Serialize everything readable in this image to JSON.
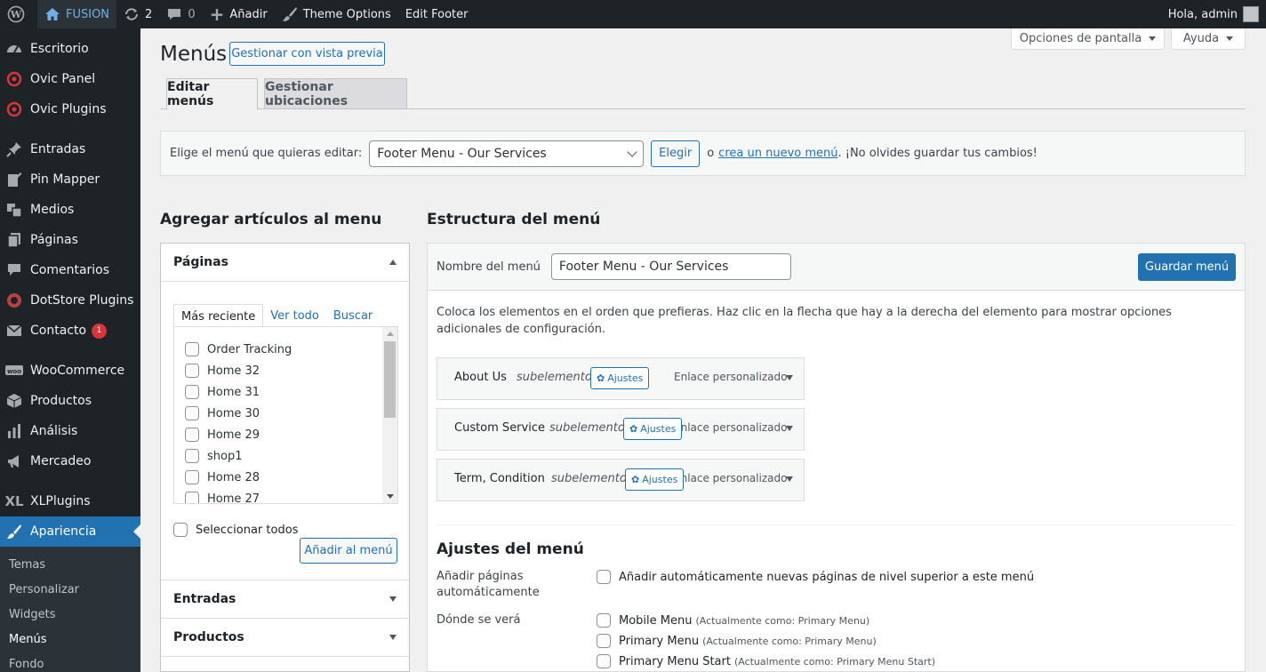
{
  "adminbar": {
    "site_name": "FUSION",
    "updates_count": "2",
    "comments_count": "0",
    "add_new": "Añadir",
    "theme_options": "Theme Options",
    "edit_footer": "Edit Footer",
    "greeting": "Hola, admin"
  },
  "sidebar": {
    "items": [
      {
        "label": "Escritorio",
        "icon": "dashboard-icon"
      },
      {
        "label": "Ovic Panel",
        "icon": "target-icon"
      },
      {
        "label": "Ovic Plugins",
        "icon": "target-icon"
      },
      {
        "label": "Entradas",
        "icon": "pin-icon"
      },
      {
        "label": "Pin Mapper",
        "icon": "edit-page-icon"
      },
      {
        "label": "Medios",
        "icon": "media-icon"
      },
      {
        "label": "Páginas",
        "icon": "pages-icon"
      },
      {
        "label": "Comentarios",
        "icon": "comment-icon"
      },
      {
        "label": "DotStore Plugins",
        "icon": "dotstore-icon"
      },
      {
        "label": "Contacto",
        "icon": "mail-icon",
        "badge": "1"
      },
      {
        "label": "WooCommerce",
        "icon": "woo-icon"
      },
      {
        "label": "Productos",
        "icon": "products-icon"
      },
      {
        "label": "Análisis",
        "icon": "chart-icon"
      },
      {
        "label": "Mercadeo",
        "icon": "megaphone-icon"
      },
      {
        "label": "XLPlugins",
        "icon": "xl-icon"
      },
      {
        "label": "Apariencia",
        "icon": "brush-icon"
      }
    ],
    "submenu": [
      "Temas",
      "Personalizar",
      "Widgets",
      "Menús",
      "Fondo"
    ]
  },
  "page": {
    "title": "Menús",
    "manage_preview": "Gestionar con vista previa",
    "screen_options": "Opciones de pantalla",
    "help": "Ayuda",
    "tabs": [
      "Editar menús",
      "Gestionar ubicaciones"
    ]
  },
  "manage": {
    "label": "Elige el menú que quieras editar:",
    "selected_menu": "Footer Menu - Our Services",
    "choose_button": "Elegir",
    "or_text": "o",
    "create_link": "crea un nuevo menú",
    "reminder": ". ¡No olvides guardar tus cambios!"
  },
  "add_items": {
    "heading": "Agregar artículos al menu",
    "pages_title": "Páginas",
    "tabs": [
      "Más reciente",
      "Ver todo",
      "Buscar"
    ],
    "pages": [
      "Order Tracking",
      "Home 32",
      "Home 31",
      "Home 30",
      "Home 29",
      "shop1",
      "Home 28",
      "Home 27"
    ],
    "select_all": "Seleccionar todos",
    "add_button": "Añadir al menú",
    "sections": [
      "Entradas",
      "Productos"
    ]
  },
  "structure": {
    "heading": "Estructura del menú",
    "name_label": "Nombre del menú",
    "name_value": "Footer Menu - Our Services",
    "save_button": "Guardar menú",
    "instructions": "Coloca los elementos en el orden que prefieras. Haz clic en la flecha que hay a la derecha del elemento para mostrar opciones adicionales de configuración.",
    "items": [
      {
        "title": "About Us",
        "sub": "subelemento",
        "settings": "Ajustes",
        "type": "Enlace personalizado"
      },
      {
        "title": "Custom Service",
        "sub": "subelemento",
        "settings": "Ajustes",
        "type": "Enlace personalizado"
      },
      {
        "title": "Term, Condition",
        "sub": "subelemento",
        "settings": "Ajustes",
        "type": "Enlace personalizado"
      }
    ]
  },
  "menu_settings": {
    "heading": "Ajustes del menú",
    "auto_add_label": "Añadir páginas automáticamente",
    "auto_add_option": "Añadir automáticamente nuevas páginas de nivel superior a este menú",
    "location_label": "Dónde se verá",
    "locations": [
      {
        "name": "Mobile Menu",
        "note": "(Actualmente como: Primary Menu)"
      },
      {
        "name": "Primary Menu",
        "note": "(Actualmente como: Primary Menu)"
      },
      {
        "name": "Primary Menu Start",
        "note": "(Actualmente como: Primary Menu Start)"
      }
    ]
  }
}
